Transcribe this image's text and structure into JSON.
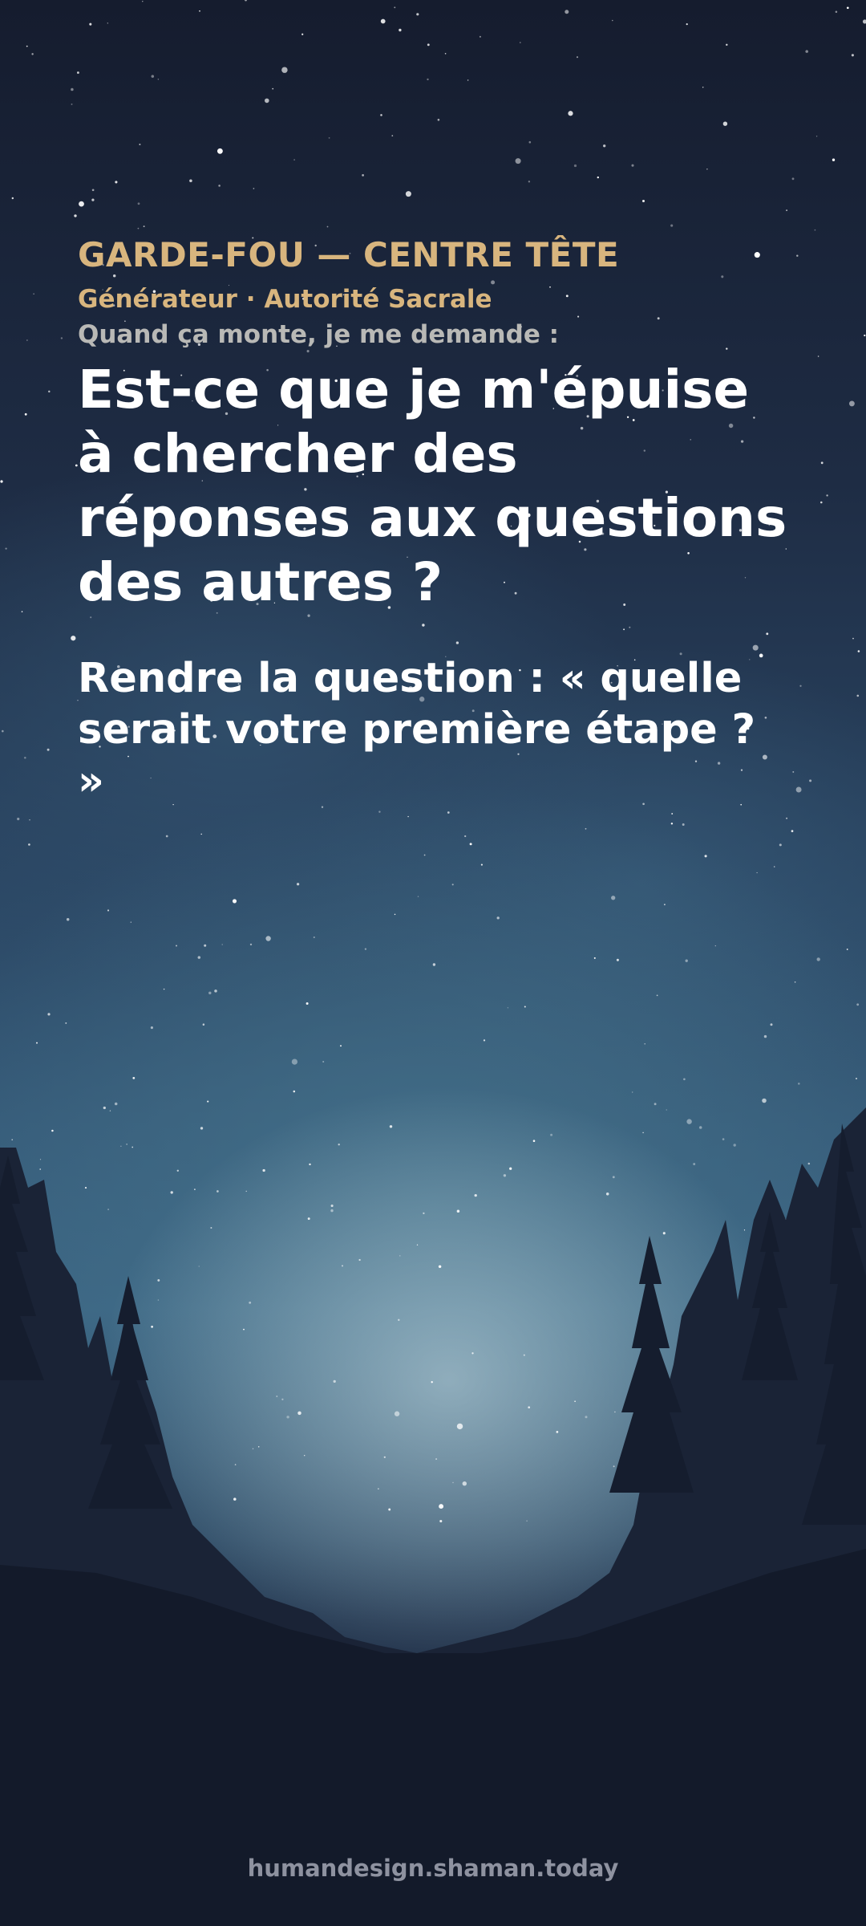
{
  "card": {
    "kicker": "GARDE-FOU — CENTRE TÊTE",
    "subtitle": "Générateur · Autorité Sacrale",
    "prompt": "Quand ça monte, je me demande :",
    "question": "Est-ce que je m'épuise à chercher des réponses aux questions des autres ?",
    "answer": "Rendre la question : « quelle serait votre première étape ? »"
  },
  "footer": {
    "url": "humandesign.shaman.today"
  },
  "colors": {
    "accent": "#d8b57e",
    "muted": "#b9b9b6",
    "footer": "#8e92a0",
    "text": "#ffffff"
  }
}
